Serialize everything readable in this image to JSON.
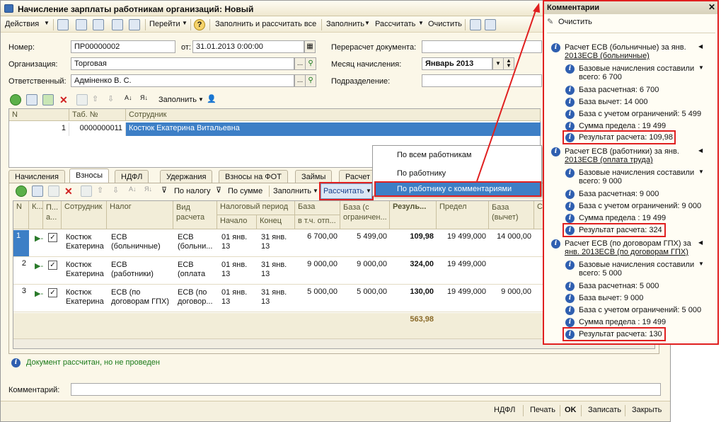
{
  "window": {
    "title": "Начисление зарплаты работникам организаций: Новый"
  },
  "toolbar": {
    "actions": "Действия",
    "goto": "Перейти",
    "fill_calc": "Заполнить и рассчитать все",
    "fill": "Заполнить",
    "calc": "Рассчитать",
    "clear": "Очистить"
  },
  "form": {
    "number_label": "Номер:",
    "number": "ПР00000002",
    "from_label": "от:",
    "date": "31.01.2013  0:00:00",
    "org_label": "Организация:",
    "org": "Торговая",
    "resp_label": "Ответственный:",
    "resp": "Адміненко В. С.",
    "recalc_label": "Перерасчет документа:",
    "month_label": "Месяц начисления:",
    "month": "Январь 2013",
    "dept_label": "Подразделение:"
  },
  "emp_toolbar": {
    "fill": "Заполнить"
  },
  "emp_grid": {
    "headers": [
      "N",
      "Таб. №",
      "Сотрудник"
    ],
    "rows": [
      {
        "n": "1",
        "tab": "0000000011",
        "name": "Костюк Екатерина Витальевна"
      }
    ]
  },
  "tabs": [
    "Начисления",
    "Взносы",
    "НДФЛ",
    "Удержания",
    "Взносы на ФОТ",
    "Займы",
    "Расчет"
  ],
  "contrib_toolbar": {
    "by_tax": "По налогу",
    "by_sum": "По сумме",
    "fill": "Заполнить",
    "calc": "Рассчитать"
  },
  "calc_menu": {
    "items": [
      "По всем работникам",
      "По работнику",
      "По работнику с комментариями"
    ]
  },
  "contrib_grid": {
    "headers": {
      "n": "N",
      "k": "К...",
      "p": "П... а...",
      "emp": "Сотрудник",
      "tax": "Налог",
      "type": "Вид расчета",
      "period": "Налоговый период",
      "start": "Начало",
      "end": "Конец",
      "base": "База",
      "base_sub": "в т.ч. отп...",
      "base_lim": "База (с ограничен...",
      "result": "Резуль...",
      "limit": "Предел",
      "base_ded": "База (вычет)",
      "c": "С"
    },
    "rows": [
      {
        "n": "1",
        "emp": "Костюк Екатерина",
        "tax": "ЕСВ (больничные)",
        "type": "ЕСВ (больни...",
        "start": "01 янв. 13",
        "end": "31 янв. 13",
        "base": "6 700,00",
        "base_lim": "5 499,00",
        "result": "109,98",
        "limit": "19 499,000",
        "base_ded": "14 000,00"
      },
      {
        "n": "2",
        "emp": "Костюк Екатерина",
        "tax": "ЕСВ (работники)",
        "type": "ЕСВ (оплата ...",
        "start": "01 янв. 13",
        "end": "31 янв. 13",
        "base": "9 000,00",
        "base_lim": "9 000,00",
        "result": "324,00",
        "limit": "19 499,000",
        "base_ded": ""
      },
      {
        "n": "3",
        "emp": "Костюк Екатерина",
        "tax": "ЕСВ (по договорам ГПХ)",
        "type": "ЕСВ (по договор...",
        "start": "01 янв. 13",
        "end": "31 янв. 13",
        "base": "5 000,00",
        "base_lim": "5 000,00",
        "result": "130,00",
        "limit": "19 499,000",
        "base_ded": "9 000,00"
      }
    ],
    "total": "563,98"
  },
  "status_msg": "Документ рассчитан, но не проведен",
  "comment_label": "Комментарий:",
  "bottom": {
    "ndfl": "НДФЛ",
    "print": "Печать",
    "ok": "OK",
    "save": "Записать",
    "close": "Закрыть"
  },
  "panel": {
    "title": "Комментарии",
    "clear": "Очистить",
    "lines": [
      {
        "lvl": 0,
        "t": "Расчет ЕСВ (больничные) за янв.",
        "icon": "info"
      },
      {
        "lvl": 0,
        "t": "2013ЕСВ (больничные)",
        "icon": "none"
      },
      {
        "lvl": 1,
        "t": "Базовые начисления составили",
        "icon": "info"
      },
      {
        "lvl": 1,
        "t": "всего: 6 700",
        "icon": "none"
      },
      {
        "lvl": 1,
        "t": "База расчетная: 6 700",
        "icon": "info"
      },
      {
        "lvl": 1,
        "t": "База вычет: 14 000",
        "icon": "info"
      },
      {
        "lvl": 1,
        "t": "База с учетом ограничений: 5 499",
        "icon": "info"
      },
      {
        "lvl": 1,
        "t": "Сумма предела : 19 499",
        "icon": "info"
      },
      {
        "lvl": 1,
        "t": "Результат расчета: 109,98",
        "icon": "info",
        "hl": true
      },
      {
        "lvl": 0,
        "t": "Расчет ЕСВ (работники) за янв.",
        "icon": "info"
      },
      {
        "lvl": 0,
        "t": "2013ЕСВ (оплата труда)",
        "icon": "none"
      },
      {
        "lvl": 1,
        "t": "Базовые начисления составили",
        "icon": "info"
      },
      {
        "lvl": 1,
        "t": "всего: 9 000",
        "icon": "none"
      },
      {
        "lvl": 1,
        "t": "База расчетная: 9 000",
        "icon": "info"
      },
      {
        "lvl": 1,
        "t": "База с учетом ограничений: 9 000",
        "icon": "info"
      },
      {
        "lvl": 1,
        "t": "Сумма предела : 19 499",
        "icon": "info"
      },
      {
        "lvl": 1,
        "t": "Результат расчета: 324",
        "icon": "info",
        "hl": true
      },
      {
        "lvl": 0,
        "t": "Расчет ЕСВ (по договорам ГПХ) за",
        "icon": "info"
      },
      {
        "lvl": 0,
        "t": "янв. 2013ЕСВ (по договорам ГПХ)",
        "icon": "none"
      },
      {
        "lvl": 1,
        "t": "Базовые начисления составили",
        "icon": "info"
      },
      {
        "lvl": 1,
        "t": "всего: 5 000",
        "icon": "none"
      },
      {
        "lvl": 1,
        "t": "База расчетная: 5 000",
        "icon": "info"
      },
      {
        "lvl": 1,
        "t": "База вычет: 9 000",
        "icon": "info"
      },
      {
        "lvl": 1,
        "t": "База с учетом ограничений: 5 000",
        "icon": "info"
      },
      {
        "lvl": 1,
        "t": "Сумма предела : 19 499",
        "icon": "info"
      },
      {
        "lvl": 1,
        "t": "Результат расчета: 130",
        "icon": "info",
        "hl": true
      }
    ]
  },
  "colors": {
    "accent_red": "#e02020",
    "selection": "#3d7fc6",
    "info_icon": "#2f5fb0"
  }
}
